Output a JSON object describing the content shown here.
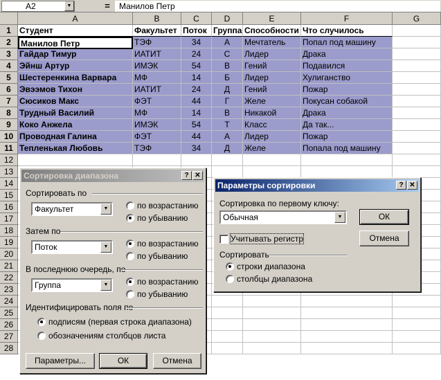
{
  "formula_bar": {
    "name_box": "A2",
    "eq": "=",
    "formula": "Манилов Петр"
  },
  "columns": [
    "A",
    "B",
    "C",
    "D",
    "E",
    "F",
    "G"
  ],
  "rows": [
    "1",
    "2",
    "3",
    "4",
    "5",
    "6",
    "7",
    "8",
    "9",
    "10",
    "11",
    "12",
    "13",
    "14",
    "15",
    "16",
    "17",
    "18",
    "19",
    "20",
    "21",
    "22",
    "23",
    "24",
    "25",
    "26",
    "27",
    "28"
  ],
  "headers": [
    "Студент",
    "Факультет",
    "Поток",
    "Группа",
    "Способности",
    "Что случилось"
  ],
  "table": [
    [
      "Манилов Петр",
      "ТЭФ",
      "34",
      "А",
      "Мечтатель",
      "Попал под машину"
    ],
    [
      "Гайдар Тимур",
      "ИАТИТ",
      "24",
      "С",
      "Лидер",
      "Драка"
    ],
    [
      "Эйнш Артур",
      "ИМЭК",
      "54",
      "В",
      "Гений",
      "Подавился"
    ],
    [
      "Шестеренкина Варвара",
      "МФ",
      "14",
      "Б",
      "Лидер",
      "Хулиганство"
    ],
    [
      "Эвээмов Тихон",
      "ИАТИТ",
      "24",
      "Д",
      "Гений",
      "Пожар"
    ],
    [
      "Сюсиков Макс",
      "ФЭТ",
      "44",
      "Г",
      "Желе",
      "Покусан собакой"
    ],
    [
      "Трудный Василий",
      "МФ",
      "14",
      "В",
      "Никакой",
      "Драка"
    ],
    [
      "Коко Анжела",
      "ИМЭК",
      "54",
      "Т",
      "Класс",
      "Да так..."
    ],
    [
      "Проводная Галина",
      "ФЭТ",
      "44",
      "А",
      "Лидер",
      "Пожар"
    ],
    [
      "Тепленькая Любовь",
      "ТЭФ",
      "34",
      "Д",
      "Желе",
      "Попала под машину"
    ]
  ],
  "sort_dialog": {
    "title": "Сортировка диапазона",
    "help": "?",
    "close": "✕",
    "sort_by_label": "Сортировать по",
    "sort_by_value": "Факультет",
    "then_by_label": "Затем по",
    "then_by_value": "Поток",
    "last_by_label": "В последнюю очередь, по",
    "last_by_value": "Группа",
    "asc": "по возрастанию",
    "desc": "по убыванию",
    "identify_label": "Идентифицировать поля по",
    "by_labels": "подписям (первая строка диапазона)",
    "by_columns": "обозначениям столбцов листа",
    "params_btn": "Параметры...",
    "ok_btn": "ОК",
    "cancel_btn": "Отмена"
  },
  "params_dialog": {
    "title": "Параметры сортировки",
    "help": "?",
    "close": "✕",
    "first_key_label": "Сортировка по первому ключу:",
    "first_key_value": "Обычная",
    "case_label": "Учитывать регистр",
    "sort_label": "Сортировать",
    "rows_opt": "строки диапазона",
    "cols_opt": "столбцы диапазона",
    "ok_btn": "ОК",
    "cancel_btn": "Отмена"
  }
}
